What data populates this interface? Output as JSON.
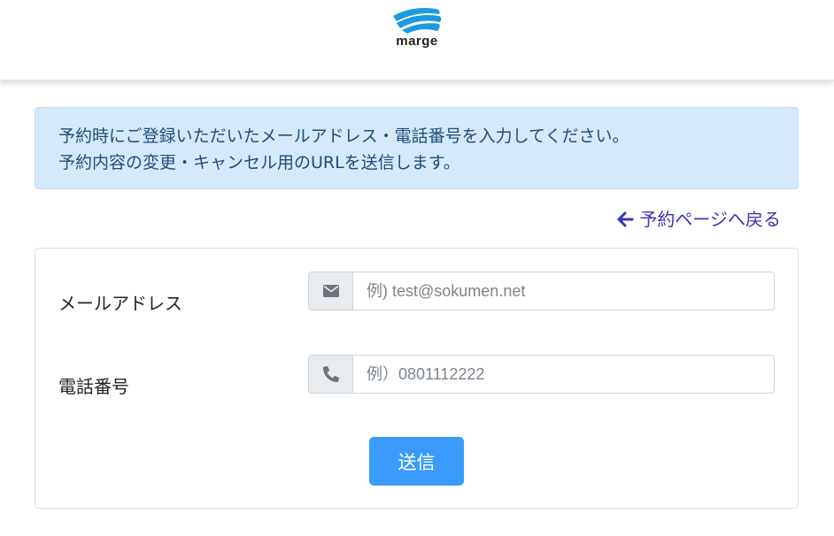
{
  "header": {
    "logo_text": "marge",
    "logo_icon": "wave-logo-icon",
    "brand_color": "#1a9ae0"
  },
  "alert": {
    "line1": "予約時にご登録いただいたメールアドレス・電話番号を入力してください。",
    "line2": "予約内容の変更・キャンセル用のURLを送信します。",
    "background": "#d6e9fb"
  },
  "back_link": {
    "label": "予約ページへ戻る",
    "icon": "arrow-left-icon",
    "color": "#3a35b8"
  },
  "form": {
    "email": {
      "label": "メールアドレス",
      "icon": "envelope-icon",
      "placeholder": "例) test@sokumen.net",
      "value": ""
    },
    "phone": {
      "label": "電話番号",
      "icon": "phone-icon",
      "placeholder": "例）0801112222",
      "value": ""
    },
    "submit_label": "送信",
    "submit_color": "#3b9bfb"
  }
}
